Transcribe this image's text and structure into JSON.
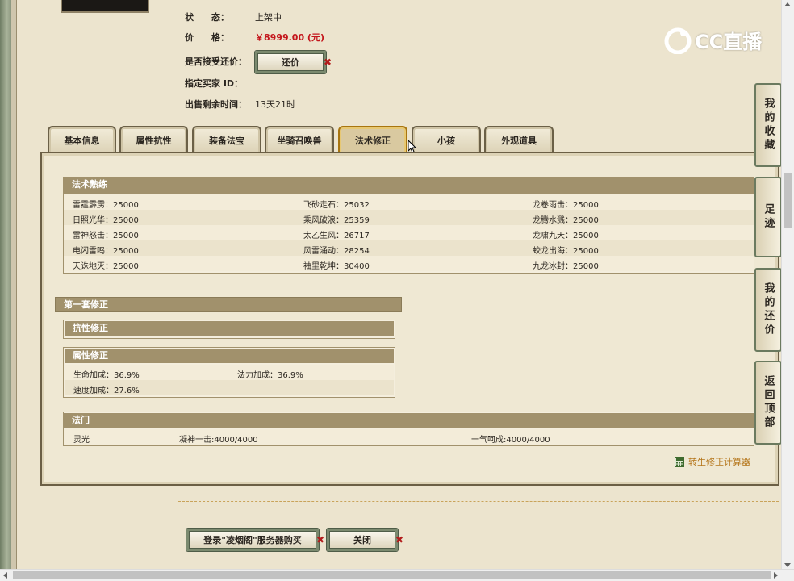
{
  "info": {
    "status_label": "状　　态：",
    "status_value": "上架中",
    "price_label": "价　　格：",
    "price_value": "￥8999.00 (元)",
    "counter_label": "是否接受还价：",
    "counter_button": "还价",
    "buyer_label": "指定买家 ID：",
    "buyer_value": "",
    "remaining_label": "出售剩余时间：",
    "remaining_value": "13天21时"
  },
  "watermark": "CC直播",
  "tabs": [
    "基本信息",
    "属性抗性",
    "装备法宝",
    "坐骑召唤兽",
    "法术修正",
    "小孩",
    "外观道具"
  ],
  "active_tab": "法术修正",
  "skills": {
    "title": "法术熟练",
    "rows": [
      [
        "雷霆霹雳：25000",
        "飞砂走石：25032",
        "龙卷雨击：25000"
      ],
      [
        "日照光华：25000",
        "乘风破浪：25359",
        "龙腾水溅：25000"
      ],
      [
        "雷神怒击：25000",
        "太乙生风：26717",
        "龙啸九天：25000"
      ],
      [
        "电闪雷鸣：25000",
        "风雷涌动：28254",
        "蛟龙出海：25000"
      ],
      [
        "天诛地灭：25000",
        "袖里乾坤：30400",
        "九龙冰封：25000"
      ]
    ]
  },
  "set1": {
    "title": "第一套修正",
    "resist_title": "抗性修正",
    "attr_title": "属性修正",
    "attr_rows": [
      [
        "生命加成：36.9%",
        "法力加成：36.9%"
      ],
      [
        "速度加成：27.6%",
        ""
      ]
    ]
  },
  "fameng": {
    "title": "法门",
    "items": [
      "灵光",
      "凝神一击:4000/4000",
      "一气呵成:4000/4000"
    ]
  },
  "calculator_link": "转生修正计算器",
  "side_tabs": [
    "我的收藏",
    "足迹",
    "我的还价",
    "返回顶部"
  ],
  "buttons": {
    "login_buy": "登录\"凌烟阁\"服务器购买",
    "close": "关闭"
  }
}
